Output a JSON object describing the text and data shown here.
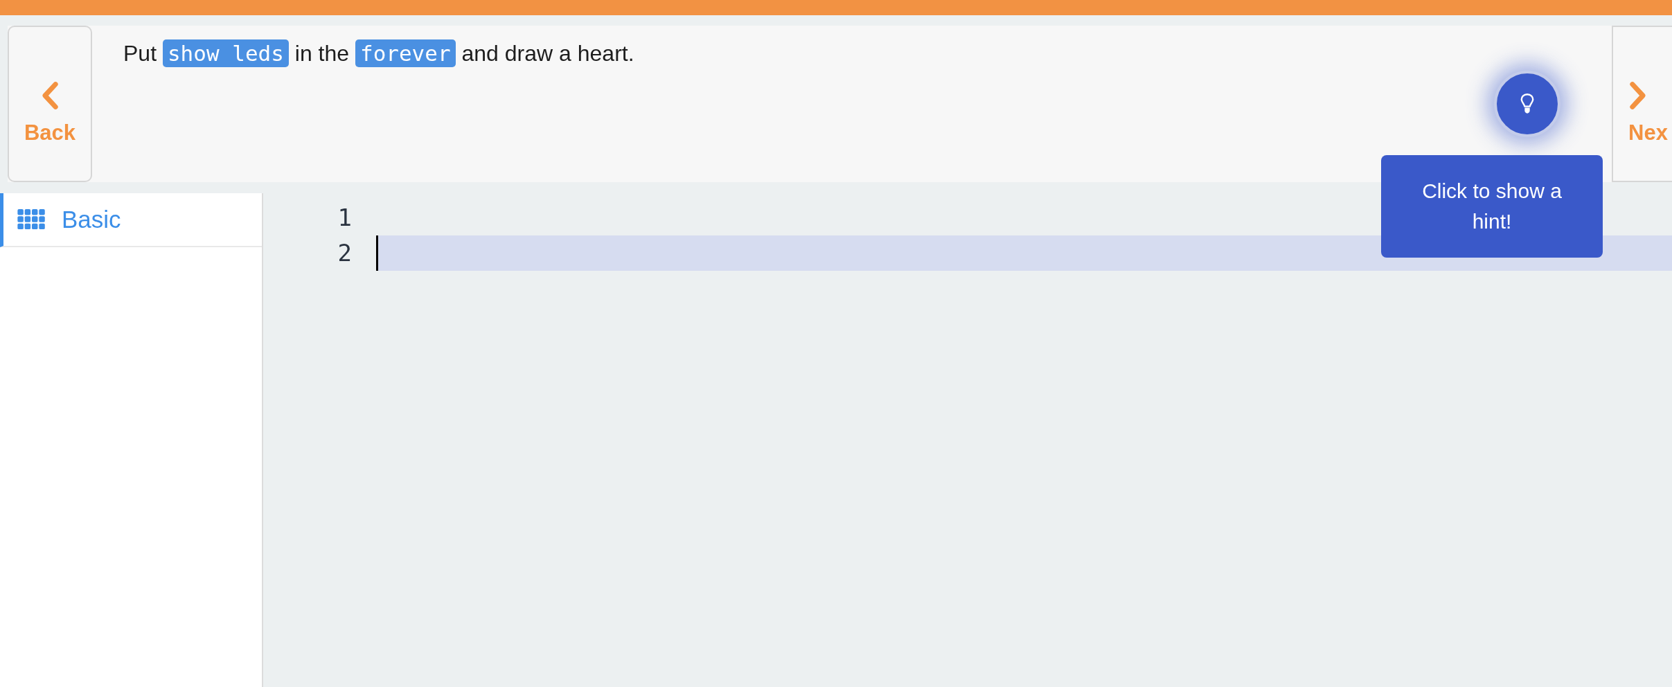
{
  "instruction": {
    "back": {
      "label": "Back"
    },
    "segments": [
      {
        "kind": "text",
        "text": "Put "
      },
      {
        "kind": "code",
        "text": "show leds"
      },
      {
        "kind": "text",
        "text": " in the "
      },
      {
        "kind": "code",
        "text": "forever"
      },
      {
        "kind": "text",
        "text": " and draw a heart."
      }
    ],
    "next": {
      "label": "Nex"
    }
  },
  "hint": {
    "tooltip": "Click to show a hint!"
  },
  "toolbox": {
    "categories": [
      {
        "label": "Basic",
        "selected": true
      }
    ]
  },
  "editor": {
    "lines": [
      {
        "number": "1",
        "current": false
      },
      {
        "number": "2",
        "current": true
      }
    ]
  }
}
